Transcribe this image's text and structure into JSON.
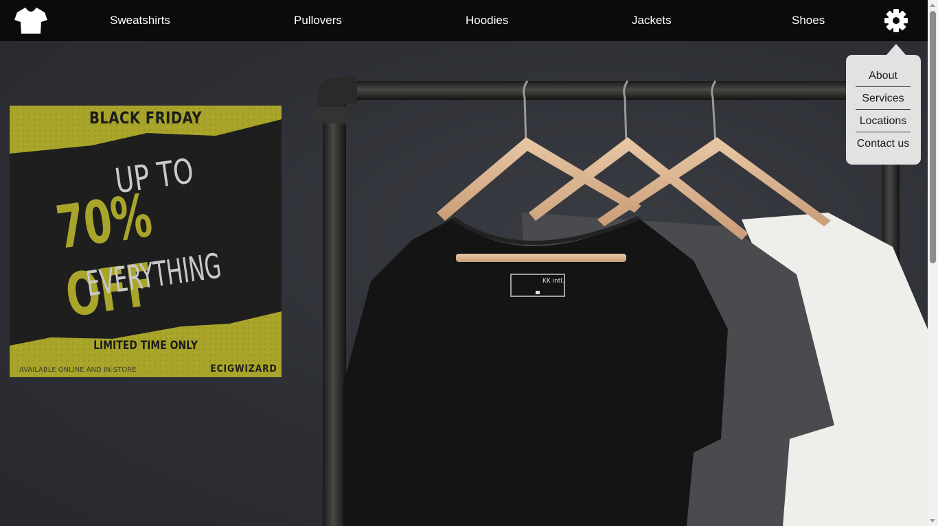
{
  "nav": {
    "logo_icon": "tshirt-icon",
    "links": [
      "Sweatshirts",
      "Pullovers",
      "Hoodies",
      "Jackets",
      "Shoes"
    ],
    "settings_icon": "gear-icon"
  },
  "dropdown": {
    "items": [
      "About",
      "Services",
      "Locations",
      "Contact us"
    ]
  },
  "promo": {
    "headline": "BLACK FRIDAY",
    "up_to": "UP TO",
    "discount": "70% OFF",
    "everything": "EVERYTHING",
    "limited": "LIMITED TIME ONLY",
    "availability": "AVAILABLE ONLINE AND IN-STORE",
    "brand": "ECIGWIZARD",
    "accent_color": "#a9a52a"
  },
  "hero": {
    "tag_brand": "KK intl."
  },
  "colors": {
    "navbar_bg": "#0b0b0c",
    "hero_bg": "#2e3036",
    "dropdown_bg": "#e2e2e2"
  }
}
